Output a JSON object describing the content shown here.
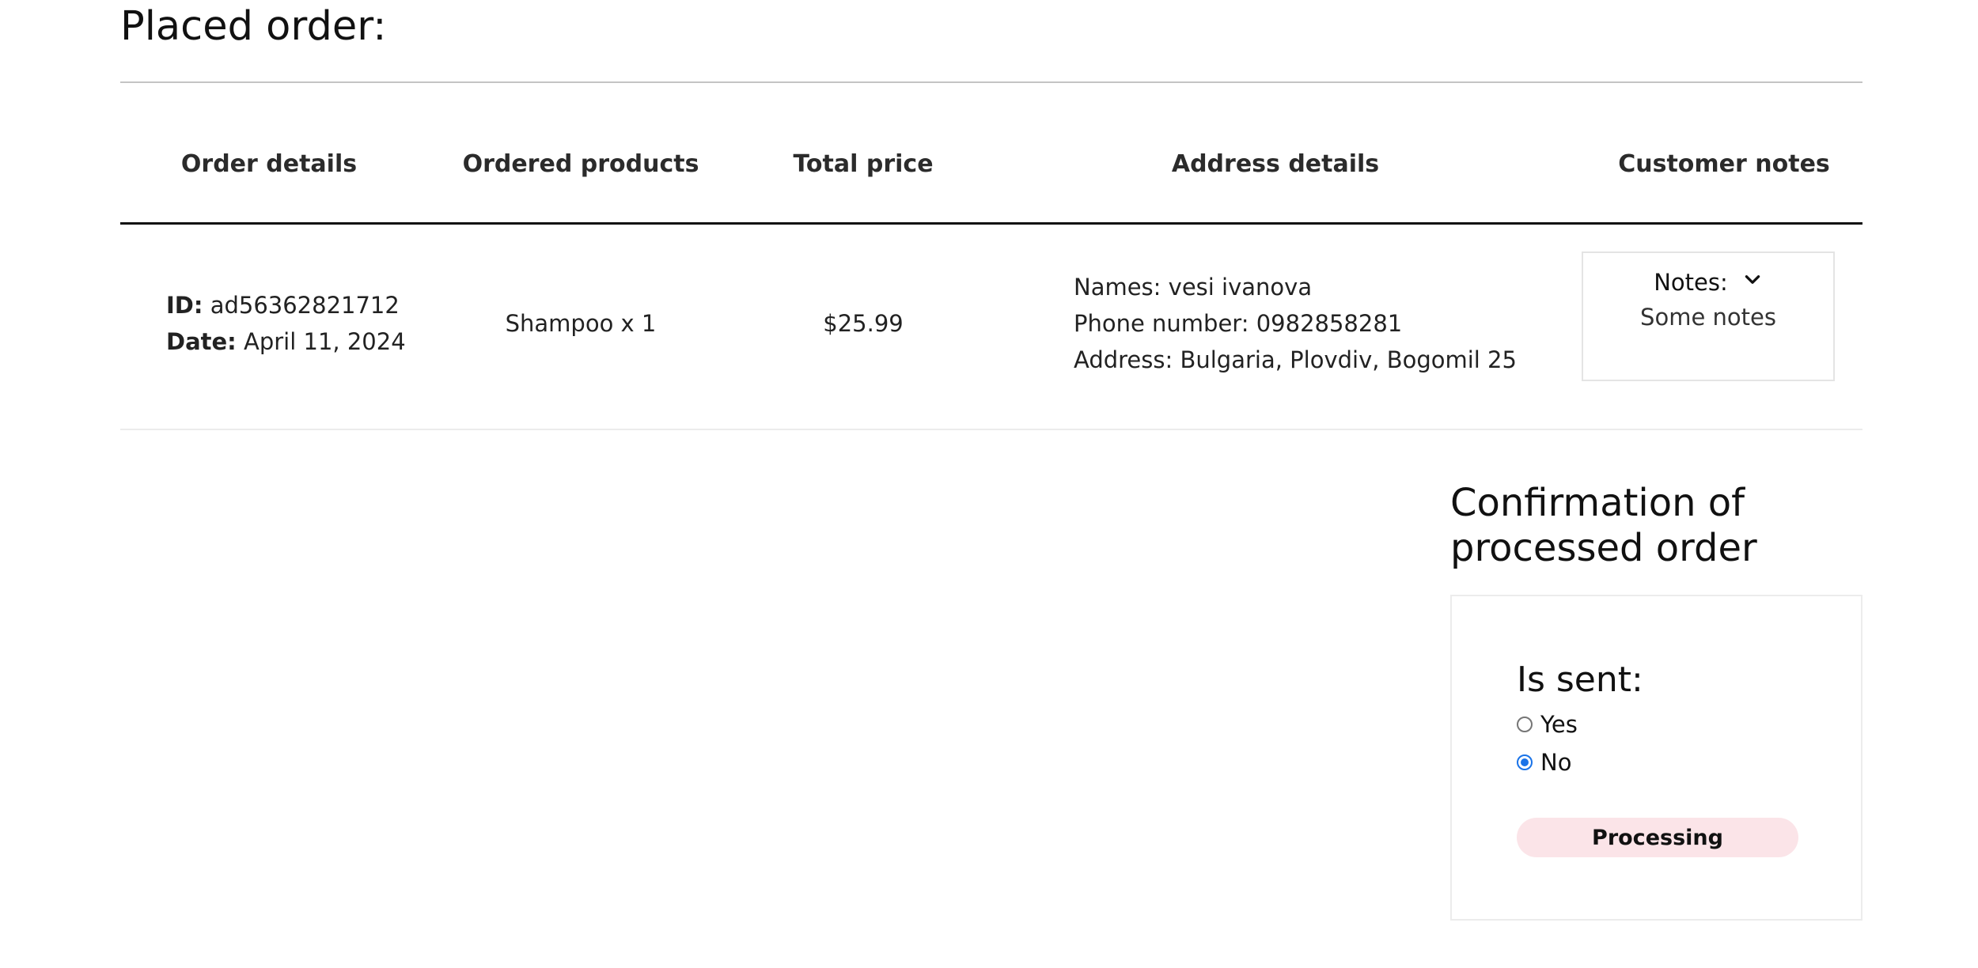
{
  "page": {
    "title": "Placed order:"
  },
  "table": {
    "headers": [
      "Order details",
      "Ordered products",
      "Total price",
      "Address details",
      "Customer notes"
    ],
    "row": {
      "order_id_label": "ID:",
      "order_id": "ad56362821712",
      "date_label": "Date:",
      "date": "April 11, 2024",
      "products": "Shampoo x 1",
      "total_price": "$25.99",
      "names": "Names: vesi ivanova",
      "phone": "Phone number: 0982858281",
      "address": "Address: Bulgaria, Plovdiv, Bogomil 25",
      "notes_label": "Notes:",
      "notes_icon": "chevron-down-icon",
      "notes_text": "Some notes"
    }
  },
  "confirmation": {
    "title_line1": "Confirmation of",
    "title_line2": "processed order",
    "is_sent_label": "Is sent:",
    "options": [
      {
        "label": "Yes",
        "checked": false
      },
      {
        "label": "No",
        "checked": true
      }
    ],
    "status_button": "Processing",
    "status_color": "#fbe4e8",
    "radio_accent": "#1a73e8"
  }
}
